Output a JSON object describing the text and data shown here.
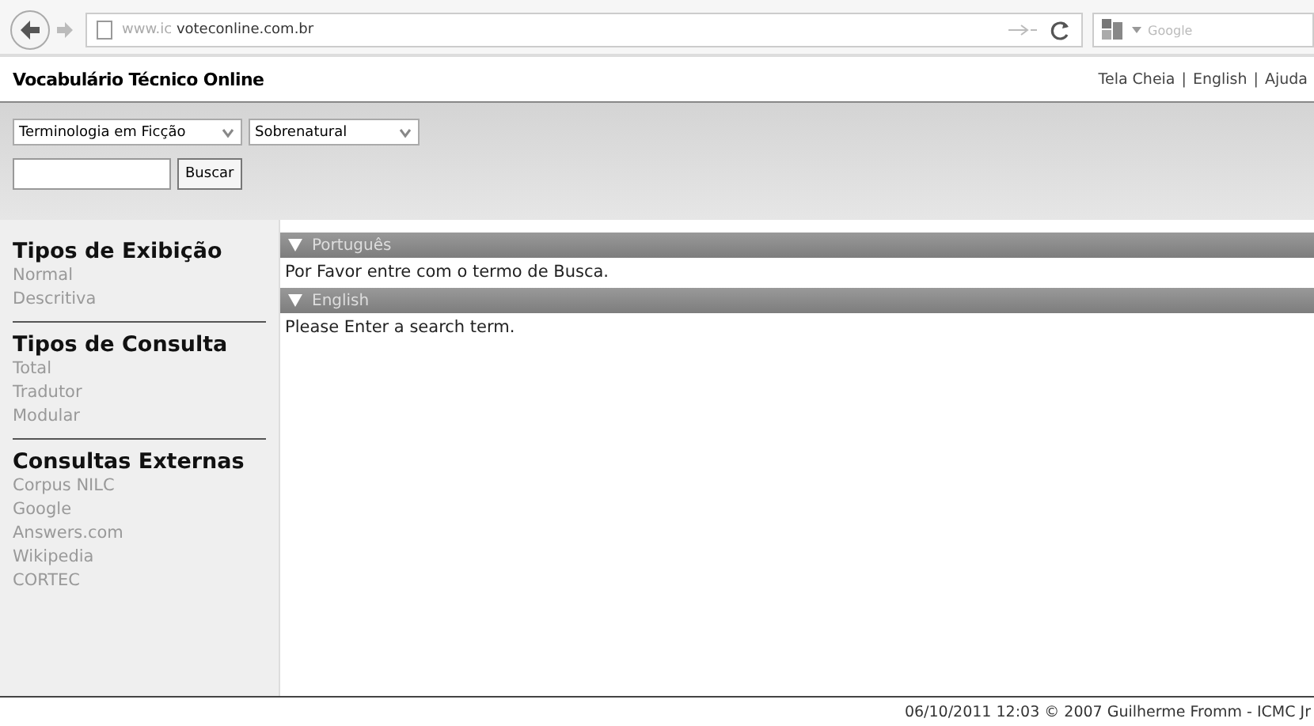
{
  "browser": {
    "url_prefix": "www.ic",
    "url_domain": "voteconline.com.br",
    "search_placeholder": "Google"
  },
  "header": {
    "title": "Vocabulário Técnico Online",
    "links": [
      "Tela Cheia",
      "English",
      "Ajuda"
    ],
    "separator": "|"
  },
  "toolbar": {
    "selects": [
      "Terminologia em Ficção",
      "Sobrenatural"
    ],
    "search_button": "Buscar"
  },
  "sidebar": [
    {
      "heading": "Tipos de Exibição",
      "items": [
        "Normal",
        "Descritiva"
      ]
    },
    {
      "heading": "Tipos de Consulta",
      "items": [
        "Total",
        "Tradutor",
        "Modular"
      ]
    },
    {
      "heading": "Consultas Externas",
      "items": [
        "Corpus NILC",
        "Google",
        "Answers.com",
        "Wikipedia",
        "CORTEC"
      ]
    }
  ],
  "panels": [
    {
      "title": "Português",
      "expanded": true,
      "text": "Por Favor entre com o termo de Busca."
    },
    {
      "title": "English",
      "expanded": true,
      "text": "Please Enter a search term."
    }
  ],
  "footer": "06/10/2011 12:03 © 2007 Guilherme Fromm - ICMC Jr"
}
